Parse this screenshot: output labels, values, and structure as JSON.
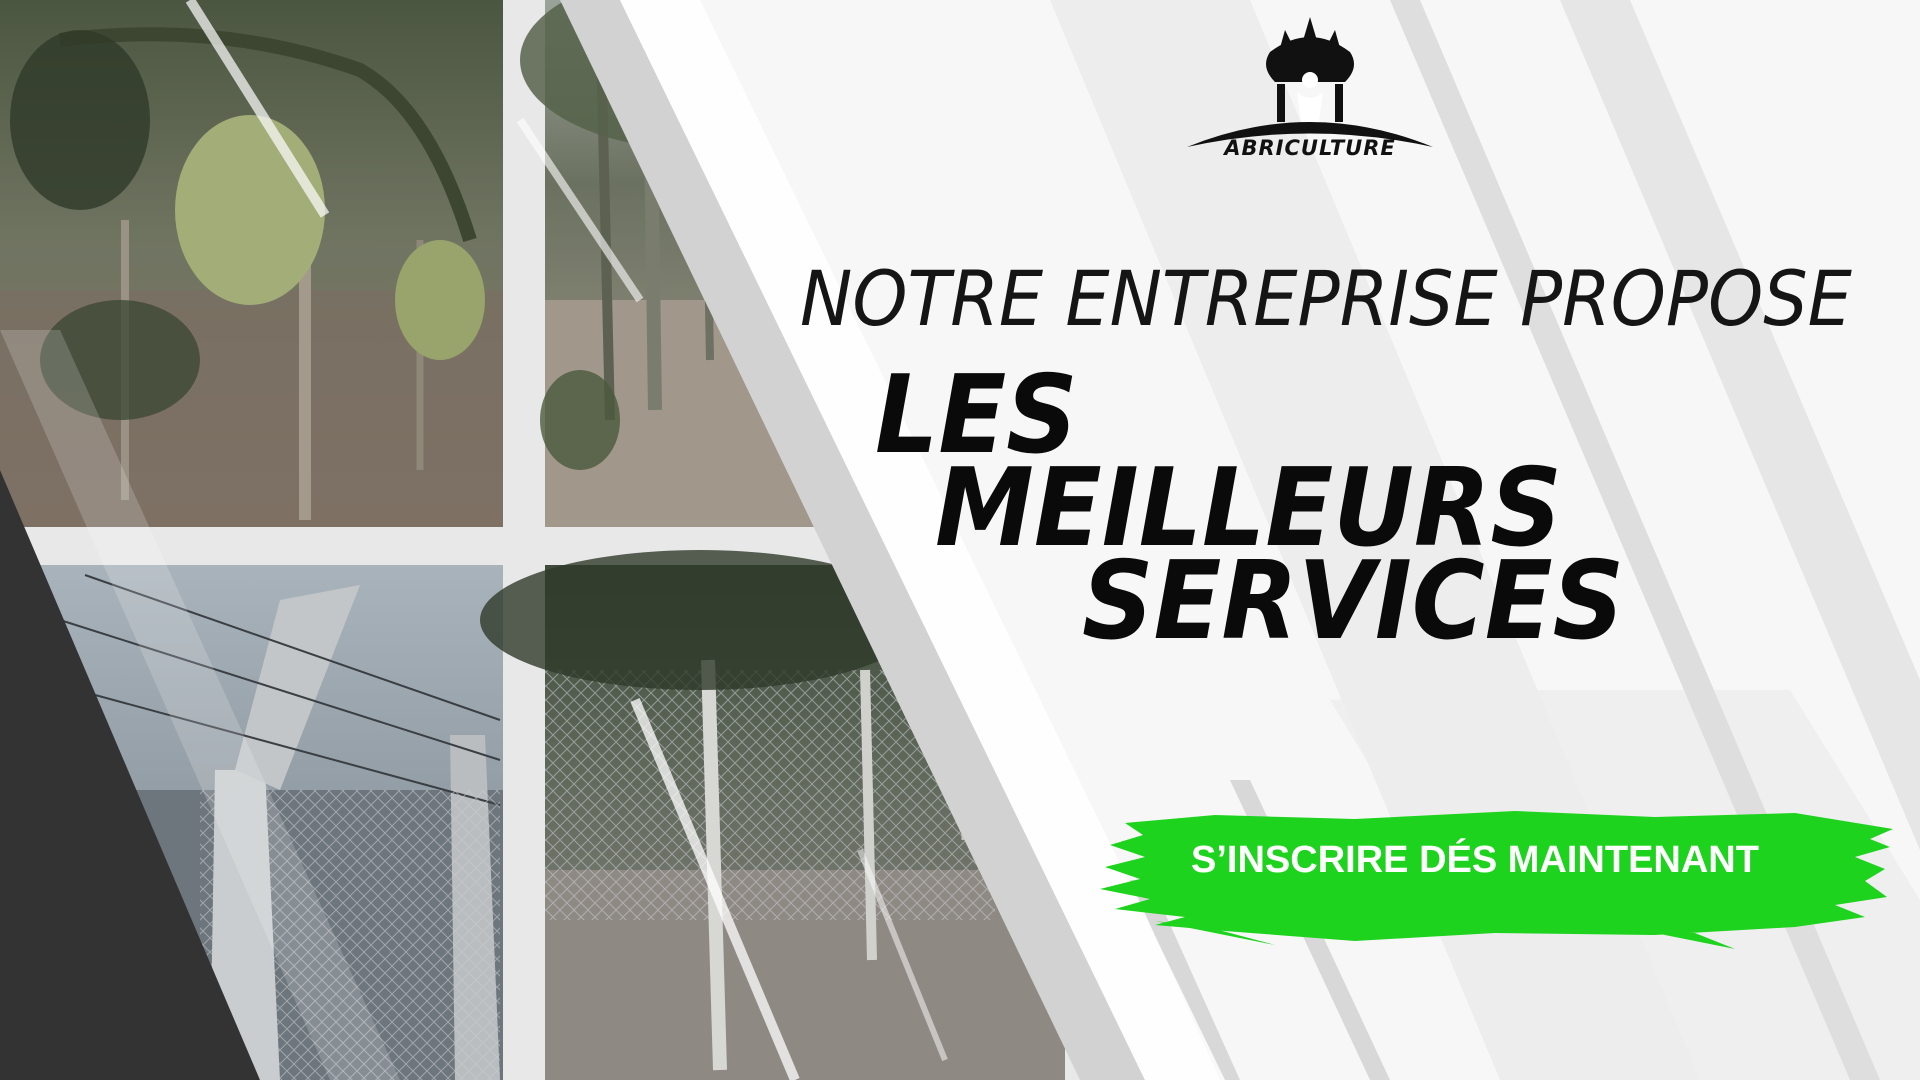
{
  "brand": {
    "name": "ABRICULTURE",
    "logo_icon": "tree-person-icon"
  },
  "hero": {
    "subtitle": "NOTRE ENTREPRISE PROPOSE",
    "headline_line1": "LES",
    "headline_line2": "MEILLEURS",
    "headline_line3": "SERVICES"
  },
  "cta": {
    "label": "S’INSCRIRE DÉS MAINTENANT",
    "color": "#1ed31e"
  },
  "photos": [
    {
      "subject": "vineyard-grapes"
    },
    {
      "subject": "orchard-rows"
    },
    {
      "subject": "barbed-wire-fence"
    },
    {
      "subject": "chain-link-fence"
    }
  ],
  "colors": {
    "background": "#f7f7f7",
    "dark_panel": "#333333",
    "stripe": "#e3e3e3",
    "text": "#0a0a0a"
  }
}
